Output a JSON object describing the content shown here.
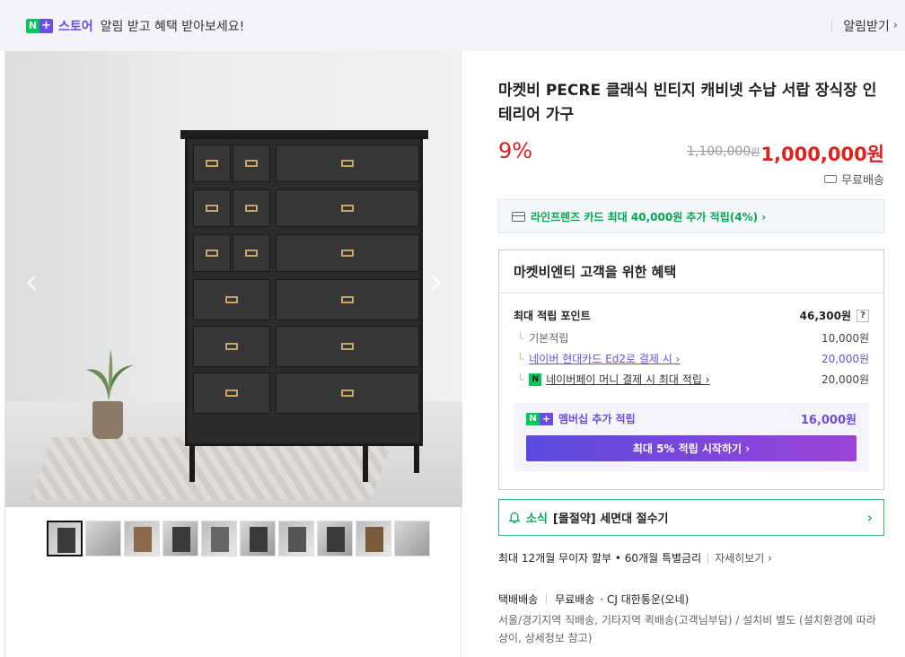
{
  "banner": {
    "logo_n": "N",
    "logo_plus": "+",
    "logo_store": "스토어",
    "message": "알림 받고 혜택 받아보세요!",
    "action_label": "알림받기"
  },
  "gallery": {
    "prev_icon": "chevron-left-icon",
    "next_icon": "chevron-right-icon",
    "thumbnail_count": 10,
    "selected_index": 0
  },
  "product": {
    "title": "마켓비 PECRE 클래식 빈티지 캐비넷 수납 서랍 장식장 인테리어 가구",
    "discount": "9%",
    "original_price": "1,100,000",
    "original_price_unit": "원",
    "sale_price": "1,000,000원",
    "shipping": "무료배송"
  },
  "card_promo": {
    "text": "라인프렌즈 카드 최대 40,000원 추가 적립(4%) ›"
  },
  "benefits": {
    "heading": "마켓비엔티 고객을 위한 혜택",
    "max_points_label": "최대 적립 포인트",
    "max_points_value": "46,300원",
    "help_label": "?",
    "items": [
      {
        "label": "기본적립",
        "value": "10,000원"
      },
      {
        "label": "네이버 현대카드 Ed2로 결제 시 ›",
        "value": "20,000원"
      },
      {
        "label": "네이버페이 머니 결제 시 최대 적립 ›",
        "value": "20,000원"
      }
    ],
    "membership_label": "멤버십 추가 적립",
    "membership_value": "16,000원",
    "membership_button": "최대 5% 적립 시작하기 ›"
  },
  "news": {
    "tag": "소식",
    "text": "[몰절약] 세면대 절수기"
  },
  "installment": {
    "text": "최대 12개월 무이자 할부 • 60개월 특별금리",
    "more": "자세히보기 ›"
  },
  "delivery": {
    "type": "택배배송",
    "fee": "무료배송",
    "carrier": "· CJ 대한통운(오네)",
    "description": "서울/경기지역 직배송, 기타지역 퀵배송(고객님부담) / 설치비 별도 (설치환경에 따라 상이, 상세정보 참고)"
  },
  "colors": {
    "accent_green": "#03c75a",
    "accent_purple": "#6c4ce3",
    "price_red": "#e0201e"
  }
}
